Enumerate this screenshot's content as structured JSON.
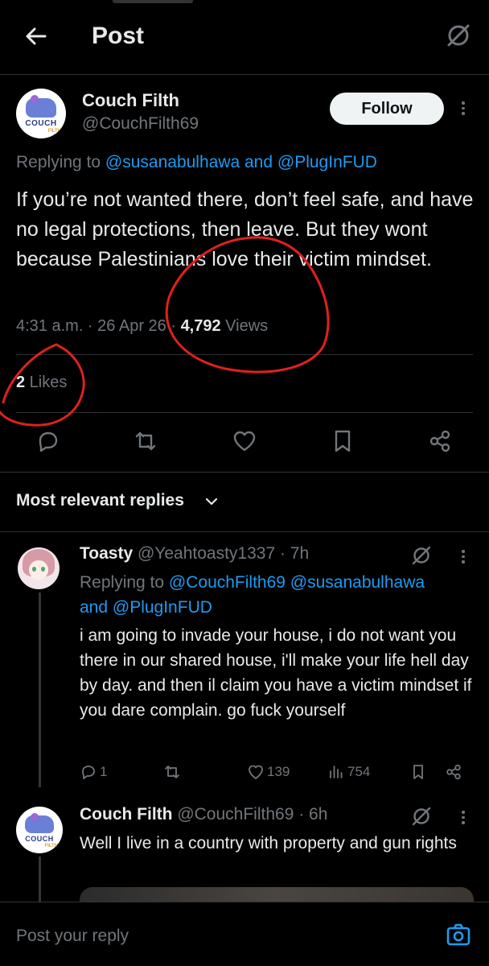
{
  "header": {
    "title": "Post",
    "back_icon": "arrow-left-icon",
    "grok_icon": "grok-icon"
  },
  "post": {
    "author_name": "Couch Filth",
    "author_handle": "@CouchFilth69",
    "avatar_text": "COUCH",
    "avatar_subtext": "FILTH",
    "follow_label": "Follow",
    "replying_prefix": "Replying to ",
    "replying_to_1": "@susanabulhawa",
    "replying_and": " and ",
    "replying_to_2": "@PlugInFUD",
    "text": "If you’re not wanted there, don’t feel safe, and have no legal protections, then leave. But they wont because Palestinians love their victim mindset.",
    "time": "4:31 a.m. · 26 Apr 26 · ",
    "views_count": "4,792",
    "views_label": " Views",
    "likes_count": "2",
    "likes_label": " Likes"
  },
  "replies_sort": {
    "label": "Most relevant replies"
  },
  "replies": [
    {
      "name": "Toasty",
      "handle": " @Yeahtoasty1337 · 7h",
      "replying_prefix": "Replying to ",
      "replying_to": "@CouchFilth69 @susanabulhawa",
      "replying_and": "and ",
      "replying_to_2": "@PlugInFUD",
      "text": "i am going to invade your house, i do not want you there in our shared house, i'll make your life hell day by day. and then il claim you have a victim mindset if you dare complain. go fuck yourself",
      "reply_count": "1",
      "like_count": "139",
      "view_count": "754"
    },
    {
      "name": "Couch Filth",
      "handle": " @CouchFilth69 · 6h",
      "text": "Well I live in a country with property and gun rights"
    }
  ],
  "composer": {
    "placeholder": "Post your reply"
  },
  "colors": {
    "accent": "#1d9bf0",
    "muted": "#71767b",
    "annotation": "#e0201e"
  }
}
